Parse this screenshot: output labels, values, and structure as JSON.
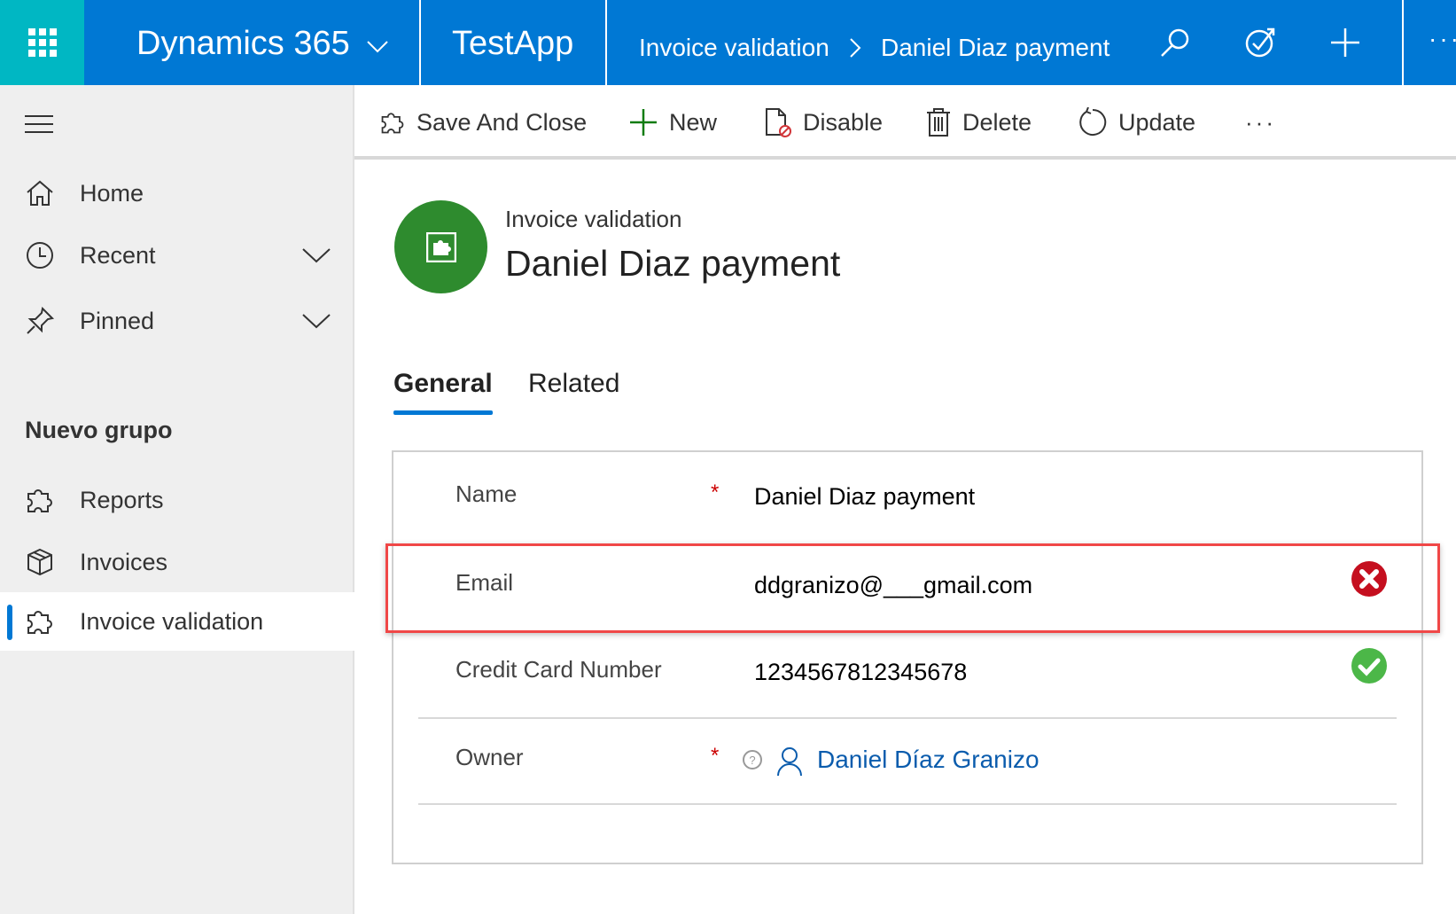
{
  "topbar": {
    "app_suite": "Dynamics 365",
    "app_name": "TestApp",
    "breadcrumb": [
      "Invoice validation",
      "Daniel Diaz payment"
    ]
  },
  "sidebar": {
    "items": [
      {
        "label": "Home",
        "icon": "home-icon"
      },
      {
        "label": "Recent",
        "icon": "clock-icon"
      },
      {
        "label": "Pinned",
        "icon": "pin-icon"
      }
    ],
    "group_title": "Nuevo grupo",
    "group_items": [
      {
        "label": "Reports",
        "icon": "puzzle-icon"
      },
      {
        "label": "Invoices",
        "icon": "box-icon"
      },
      {
        "label": "Invoice validation",
        "icon": "puzzle-icon",
        "selected": true
      }
    ]
  },
  "commands": {
    "save_close": "Save And Close",
    "new": "New",
    "disable": "Disable",
    "delete": "Delete",
    "update": "Update"
  },
  "record": {
    "entity": "Invoice validation",
    "title": "Daniel Diaz payment",
    "avatar_color": "#2e8b2e"
  },
  "tabs": [
    {
      "label": "General",
      "active": true
    },
    {
      "label": "Related",
      "active": false
    }
  ],
  "form": {
    "name": {
      "label": "Name",
      "required": "*",
      "value": "Daniel Diaz payment"
    },
    "email": {
      "label": "Email",
      "value": "ddgranizo@___gmail.com",
      "status": "invalid"
    },
    "credit_card": {
      "label": "Credit Card Number",
      "value": "1234567812345678",
      "status": "valid"
    },
    "owner": {
      "label": "Owner",
      "required": "*",
      "value": "Daniel Díaz Granizo"
    }
  },
  "colors": {
    "brand": "#0078d4",
    "accent": "#00b7c3",
    "error": "#c50f1f",
    "success": "#4cb748",
    "highlight": "#f04747"
  }
}
